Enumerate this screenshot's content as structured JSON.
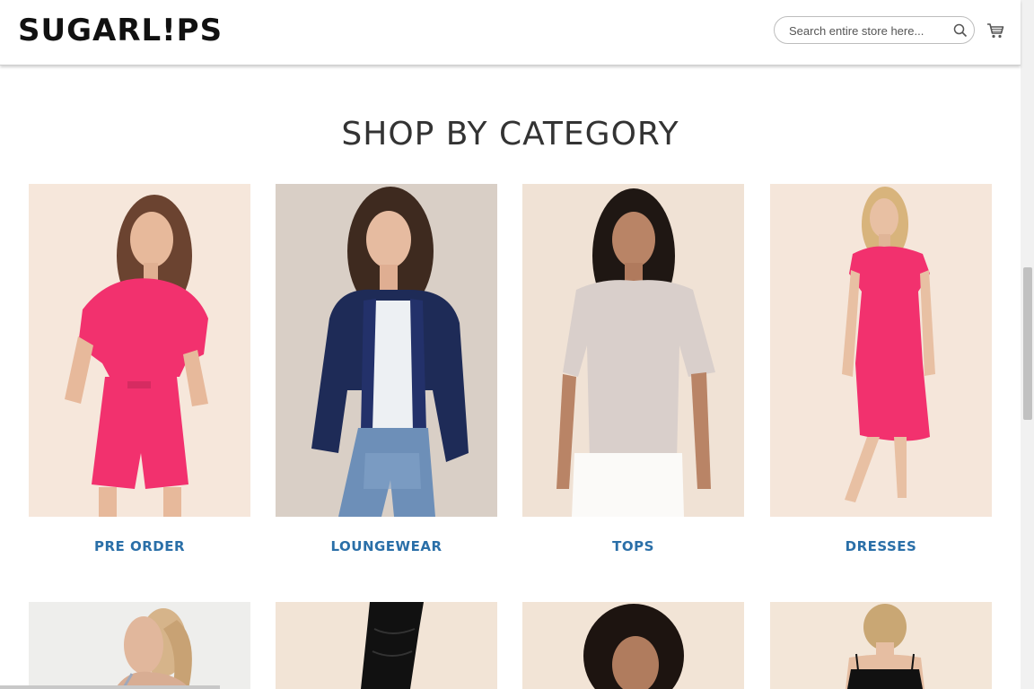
{
  "header": {
    "logo_text": "SUGARL!PS",
    "search": {
      "placeholder": "Search entire store here...",
      "icon": "search-icon"
    },
    "cart_icon": "cart-icon"
  },
  "main": {
    "section_title": "SHOP BY CATEGORY",
    "categories": [
      {
        "label": "PRE ORDER",
        "photo": "woman-in-pink-romper"
      },
      {
        "label": "LOUNGEWEAR",
        "photo": "woman-in-navy-velour-jacket"
      },
      {
        "label": "TOPS",
        "photo": "woman-in-grey-tee"
      },
      {
        "label": "DRESSES",
        "photo": "woman-in-pink-dress"
      }
    ],
    "second_row_photos": [
      {
        "photo": "woman-profile-ponytail"
      },
      {
        "photo": "black-ruched-skirt"
      },
      {
        "photo": "woman-portrait"
      },
      {
        "photo": "woman-back-black-top"
      }
    ]
  },
  "colors": {
    "link": "#2a6fa8",
    "title": "#333333",
    "pink": "#f2316e",
    "photo_bg": "#f3e3d5"
  }
}
